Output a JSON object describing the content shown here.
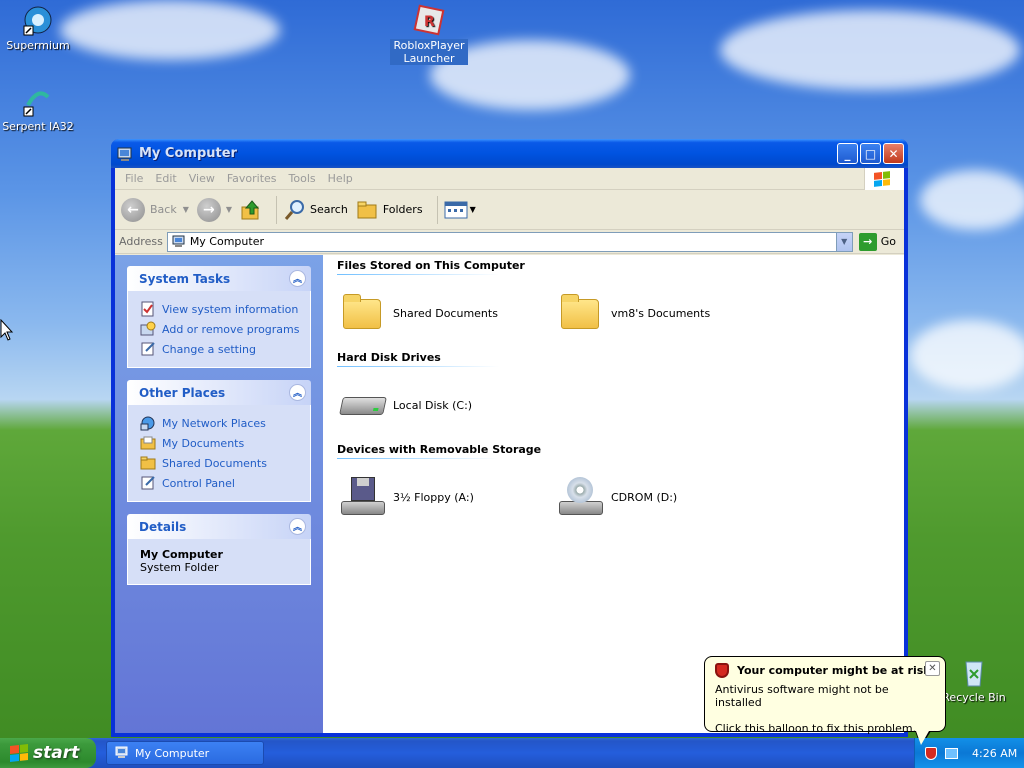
{
  "desktop": {
    "icons": [
      {
        "label": "Supermium"
      },
      {
        "label": "Serpent IA32"
      },
      {
        "label": "RobloxPlayerLauncher"
      },
      {
        "label": "Recycle Bin"
      }
    ]
  },
  "window": {
    "title": "My Computer",
    "menu": [
      "File",
      "Edit",
      "View",
      "Favorites",
      "Tools",
      "Help"
    ],
    "toolbar": {
      "back": "Back",
      "search": "Search",
      "folders": "Folders"
    },
    "address": {
      "label": "Address",
      "value": "My Computer",
      "go": "Go"
    },
    "panels": {
      "system_tasks": {
        "title": "System Tasks",
        "items": [
          "View system information",
          "Add or remove programs",
          "Change a setting"
        ]
      },
      "other_places": {
        "title": "Other Places",
        "items": [
          "My Network Places",
          "My Documents",
          "Shared Documents",
          "Control Panel"
        ]
      },
      "details": {
        "title": "Details",
        "name": "My Computer",
        "type": "System Folder"
      }
    },
    "groups": [
      {
        "title": "Files Stored on This Computer",
        "items": [
          "Shared Documents",
          "vm8's Documents"
        ]
      },
      {
        "title": "Hard Disk Drives",
        "items": [
          "Local Disk (C:)"
        ]
      },
      {
        "title": "Devices with Removable Storage",
        "items": [
          "3½ Floppy (A:)",
          "CDROM (D:)"
        ]
      }
    ]
  },
  "taskbar": {
    "start": "start",
    "task_button": "My Computer",
    "clock": "4:26 AM"
  },
  "balloon": {
    "title": "Your computer might be at risk",
    "line1": "Antivirus software might not be installed",
    "line2": "Click this balloon to fix this problem."
  }
}
